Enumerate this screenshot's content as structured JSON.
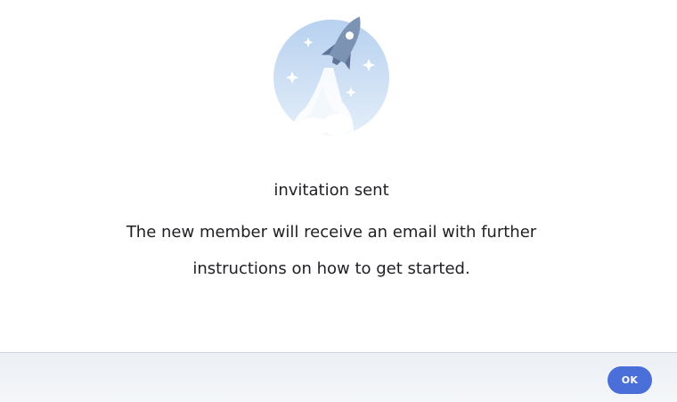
{
  "dialog": {
    "illustration": "rocket-launch-icon",
    "title": "invitation sent",
    "body_line1": "The new member will receive an email with further",
    "body_line2": "instructions on how to get started."
  },
  "footer": {
    "ok_label": "OK"
  },
  "colors": {
    "accent": "#4a6fd9",
    "circle_light": "#e8f1fb",
    "circle_dark": "#b9d3ee",
    "rocket": "#7d93b4"
  }
}
